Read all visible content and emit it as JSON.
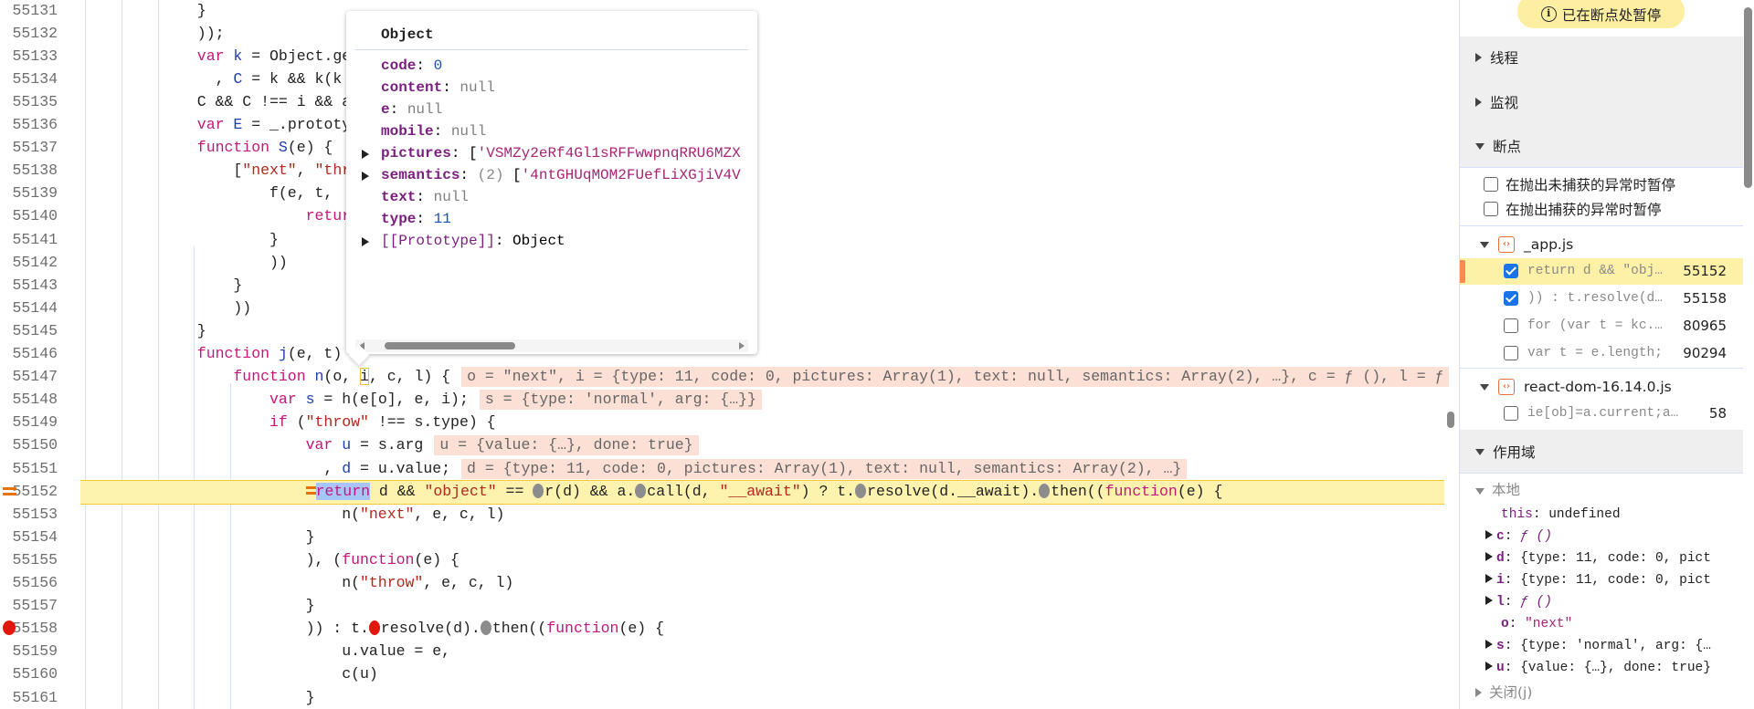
{
  "editor": {
    "lines": [
      {
        "num": "55131",
        "indent": 12,
        "tokens": [
          [
            "p",
            "}"
          ]
        ]
      },
      {
        "num": "55132",
        "indent": 12,
        "tokens": [
          [
            "p",
            "));"
          ]
        ]
      },
      {
        "num": "55133",
        "indent": 12,
        "tokens": [
          [
            "k",
            "var"
          ],
          [
            "p",
            " "
          ],
          [
            "d",
            "k"
          ],
          [
            "p",
            " = Object.ge"
          ]
        ]
      },
      {
        "num": "55134",
        "indent": 14,
        "tokens": [
          [
            "p",
            ", "
          ],
          [
            "d",
            "C"
          ],
          [
            "p",
            " = k && k(k"
          ]
        ]
      },
      {
        "num": "55135",
        "indent": 12,
        "tokens": [
          [
            "p",
            "C && C !== i && a"
          ]
        ]
      },
      {
        "num": "55136",
        "indent": 12,
        "tokens": [
          [
            "k",
            "var"
          ],
          [
            "p",
            " "
          ],
          [
            "d",
            "E"
          ],
          [
            "p",
            " = _.prototy"
          ]
        ]
      },
      {
        "num": "55137",
        "indent": 12,
        "tokens": [
          [
            "k",
            "function"
          ],
          [
            "p",
            " "
          ],
          [
            "d",
            "S"
          ],
          [
            "p",
            "(e) {"
          ]
        ]
      },
      {
        "num": "55138",
        "indent": 16,
        "tokens": [
          [
            "p",
            "["
          ],
          [
            "s",
            "\"next\""
          ],
          [
            "p",
            ", "
          ],
          [
            "s",
            "\"thr"
          ]
        ]
      },
      {
        "num": "55139",
        "indent": 20,
        "tokens": [
          [
            "p",
            "f(e, t, "
          ]
        ]
      },
      {
        "num": "55140",
        "indent": 24,
        "tokens": [
          [
            "k",
            "retur"
          ]
        ]
      },
      {
        "num": "55141",
        "indent": 20,
        "tokens": [
          [
            "p",
            "}"
          ]
        ]
      },
      {
        "num": "55142",
        "indent": 20,
        "tokens": [
          [
            "p",
            "))"
          ]
        ]
      },
      {
        "num": "55143",
        "indent": 16,
        "tokens": [
          [
            "p",
            "}"
          ]
        ]
      },
      {
        "num": "55144",
        "indent": 16,
        "tokens": [
          [
            "p",
            "))"
          ]
        ]
      },
      {
        "num": "55145",
        "indent": 12,
        "tokens": [
          [
            "p",
            "}"
          ]
        ]
      },
      {
        "num": "55146",
        "indent": 12,
        "tokens": [
          [
            "k",
            "function"
          ],
          [
            "p",
            " "
          ],
          [
            "d",
            "j"
          ],
          [
            "p",
            "(e, t) {"
          ]
        ]
      },
      {
        "num": "55147",
        "indent": 16,
        "tokens": [
          [
            "k",
            "function"
          ],
          [
            "p",
            " "
          ],
          [
            "d",
            "n"
          ],
          [
            "p",
            "(o, "
          ],
          [
            "hl",
            "i"
          ],
          [
            "p",
            ", c, l) {"
          ]
        ],
        "annotation": "o = \"next\", i = {type: 11, code: 0, pictures: Array(1), text: null, semantics: Array(2), …}, c = ƒ (), l = ƒ"
      },
      {
        "num": "55148",
        "indent": 20,
        "tokens": [
          [
            "k",
            "var"
          ],
          [
            "p",
            " "
          ],
          [
            "d",
            "s"
          ],
          [
            "p",
            " = h(e[o], e, i);"
          ]
        ],
        "annotation": "s = {type: 'normal', arg: {…}}"
      },
      {
        "num": "55149",
        "indent": 20,
        "tokens": [
          [
            "k",
            "if"
          ],
          [
            "p",
            " ("
          ],
          [
            "s",
            "\"throw\""
          ],
          [
            "p",
            " !== s.type) {"
          ]
        ]
      },
      {
        "num": "55150",
        "indent": 24,
        "tokens": [
          [
            "k",
            "var"
          ],
          [
            "p",
            " "
          ],
          [
            "d",
            "u"
          ],
          [
            "p",
            " = s.arg"
          ]
        ],
        "annotation": "u = {value: {…}, done: true}"
      },
      {
        "num": "55151",
        "indent": 26,
        "tokens": [
          [
            "p",
            ", "
          ],
          [
            "d",
            "d"
          ],
          [
            "p",
            " = u.value;"
          ]
        ],
        "annotation": "d = {type: 11, code: 0, pictures: Array(1), text: null, semantics: Array(2), …}"
      },
      {
        "num": "55152",
        "indent": 24,
        "current": true,
        "tokens": [
          [
            "exec",
            ""
          ],
          [
            "sel",
            "return"
          ],
          [
            "p",
            " d && "
          ],
          [
            "s",
            "\"object\""
          ],
          [
            "p",
            " == "
          ],
          [
            "dot",
            ""
          ],
          [
            "p",
            "r(d) && a."
          ],
          [
            "dot",
            ""
          ],
          [
            "p",
            "call(d, "
          ],
          [
            "s",
            "\"__await\""
          ],
          [
            "p",
            ") ? t."
          ],
          [
            "dot",
            ""
          ],
          [
            "p",
            "resolve(d.__await)."
          ],
          [
            "dot",
            ""
          ],
          [
            "p",
            "then(("
          ],
          [
            "k",
            "function"
          ],
          [
            "p",
            "(e) {"
          ]
        ]
      },
      {
        "num": "55153",
        "indent": 28,
        "tokens": [
          [
            "p",
            "n("
          ],
          [
            "s",
            "\"next\""
          ],
          [
            "p",
            ", e, c, l)"
          ]
        ]
      },
      {
        "num": "55154",
        "indent": 24,
        "tokens": [
          [
            "p",
            "}"
          ]
        ]
      },
      {
        "num": "55155",
        "indent": 24,
        "tokens": [
          [
            "p",
            "), ("
          ],
          [
            "k",
            "function"
          ],
          [
            "p",
            "(e) {"
          ]
        ]
      },
      {
        "num": "55156",
        "indent": 28,
        "tokens": [
          [
            "p",
            "n("
          ],
          [
            "s",
            "\"throw\""
          ],
          [
            "p",
            ", e, c, l)"
          ]
        ]
      },
      {
        "num": "55157",
        "indent": 24,
        "tokens": [
          [
            "p",
            "}"
          ]
        ]
      },
      {
        "num": "55158",
        "indent": 24,
        "breakpoint": true,
        "tokens": [
          [
            "p",
            ")) : t."
          ],
          [
            "rdot",
            ""
          ],
          [
            "p",
            "resolve(d)."
          ],
          [
            "dot",
            ""
          ],
          [
            "p",
            "then(("
          ],
          [
            "k",
            "function"
          ],
          [
            "p",
            "(e) {"
          ]
        ]
      },
      {
        "num": "55159",
        "indent": 28,
        "tokens": [
          [
            "p",
            "u.value = e,"
          ]
        ]
      },
      {
        "num": "55160",
        "indent": 28,
        "tokens": [
          [
            "p",
            "c(u)"
          ]
        ]
      },
      {
        "num": "55161",
        "indent": 24,
        "tokens": [
          [
            "p",
            "}"
          ]
        ]
      }
    ]
  },
  "popup": {
    "title": "Object",
    "rows": [
      {
        "key": "code",
        "sep": ": ",
        "value": "0",
        "kind": "num",
        "expandable": false
      },
      {
        "key": "content",
        "sep": ": ",
        "value": "null",
        "kind": "null",
        "expandable": false
      },
      {
        "key": "e",
        "sep": ": ",
        "value": "null",
        "kind": "null",
        "expandable": false
      },
      {
        "key": "mobile",
        "sep": ": ",
        "value": "null",
        "kind": "null",
        "expandable": false
      },
      {
        "key": "pictures",
        "sep": ": ",
        "prefix": "[",
        "value": "'VSMZy2eRf4Gl1sRFFwwpnqRRU6MZX",
        "kind": "str",
        "expandable": true
      },
      {
        "key": "semantics",
        "sep": ": ",
        "count": "(2) ",
        "prefix": "[",
        "value": "'4ntGHUqMOM2FUefLiXGjiV4V",
        "kind": "str",
        "expandable": true
      },
      {
        "key": "text",
        "sep": ": ",
        "value": "null",
        "kind": "null",
        "expandable": false
      },
      {
        "key": "type",
        "sep": ": ",
        "value": "11",
        "kind": "num",
        "expandable": false
      },
      {
        "key": "[[Prototype]]",
        "sep": ": ",
        "value": "Object",
        "kind": "proto",
        "expandable": true
      }
    ]
  },
  "sidebar": {
    "paused_label": "已在断点处暂停",
    "sections": {
      "threads": "线程",
      "watch": "监视",
      "breakpoints": "断点",
      "scope": "作用域"
    },
    "pause_options": [
      "在抛出未捕获的异常时暂停",
      "在抛出捕获的异常时暂停"
    ],
    "files": [
      {
        "name": "_app.js",
        "breakpoints": [
          {
            "snippet": "return d && \"obj…",
            "line": "55152",
            "checked": true,
            "current": true
          },
          {
            "snippet": ")) : t.resolve(d…",
            "line": "55158",
            "checked": true
          },
          {
            "snippet": "for (var t = kc.…",
            "line": "80965",
            "checked": false
          },
          {
            "snippet": "var t = e.length;",
            "line": "90294",
            "checked": false
          }
        ]
      },
      {
        "name": "react-dom-16.14.0.js",
        "breakpoints": [
          {
            "snippet": "ie[ob]=a.current;a…",
            "line": "58",
            "checked": false
          }
        ]
      }
    ],
    "scope": {
      "local_label": "本地",
      "vars": [
        {
          "key": "this",
          "value": "undefined",
          "kind": "val",
          "expandable": false
        },
        {
          "key": "c",
          "value": "ƒ ()",
          "kind": "fn",
          "expandable": true
        },
        {
          "key": "d",
          "value": "{type: 11, code: 0, pict",
          "kind": "val",
          "expandable": true
        },
        {
          "key": "i",
          "value": "{type: 11, code: 0, pict",
          "kind": "val",
          "expandable": true
        },
        {
          "key": "l",
          "value": "ƒ ()",
          "kind": "fn",
          "expandable": true
        },
        {
          "key": "o",
          "value": "\"next\"",
          "kind": "str",
          "expandable": false
        },
        {
          "key": "s",
          "value": "{type: 'normal', arg: {…",
          "kind": "val",
          "expandable": true
        },
        {
          "key": "u",
          "value": "{value: {…}, done: true}",
          "kind": "val",
          "expandable": true
        }
      ],
      "closure_label": "关闭(j)"
    }
  }
}
